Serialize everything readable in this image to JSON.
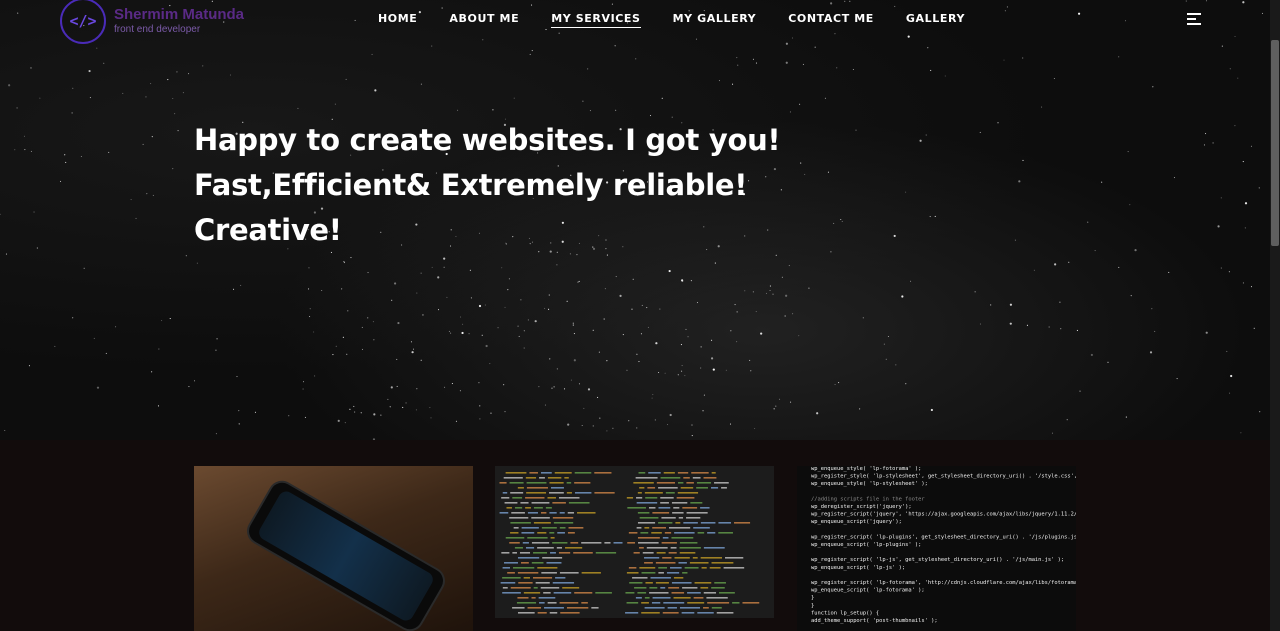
{
  "brand": {
    "logo_glyph": "</>",
    "name": "Shermim Matunda",
    "subtitle": "front end developer"
  },
  "nav": {
    "items": [
      "HOME",
      "ABOUT ME",
      "MY SERVICES",
      "MY GALLERY",
      "CONTACT ME",
      "GALLERY"
    ],
    "active_index": 2
  },
  "hero": {
    "lines": [
      "Happy to create websites. I got you!",
      "Fast,Efficient& Extremely reliable!",
      "Creative!"
    ]
  },
  "colors": {
    "accent": "#4a2bb8",
    "hero_bg": "#0d0d0d",
    "gallery_bg": "#120c0c"
  },
  "code": {
    "card3_lines": [
      "wp_enqueue_style( 'lp-fotorama' );",
      "wp_register_style( 'lp-stylesheet', get_stylesheet_directory_uri() . '/style.css', array(), null );",
      "wp_enqueue_style( 'lp-stylesheet' );",
      "",
      "//adding scripts file in the footer",
      "wp_deregister_script('jquery');",
      "wp_register_script('jquery', 'https://ajax.googleapis.com/ajax/libs/jquery/1.11.2/jquery.min.js');",
      "wp_enqueue_script('jquery');",
      "",
      "wp_register_script( 'lp-plugins', get_stylesheet_directory_uri() . '/js/plugins.js', array() );",
      "wp_enqueue_script( 'lp-plugins' );",
      "",
      "wp_register_script( 'lp-js', get_stylesheet_directory_uri() . '/js/main.js' );",
      "wp_enqueue_script( 'lp-js' );",
      "",
      "wp_register_script( 'lp-fotorama', 'http://cdnjs.cloudflare.com/ajax/libs/fotorama/4.6.4/fotorama.js' );",
      "wp_enqueue_script( 'lp-fotorama' );",
      "}",
      "}",
      "function lp_setup() {",
      "  add_theme_support( 'post-thumbnails' );"
    ]
  }
}
